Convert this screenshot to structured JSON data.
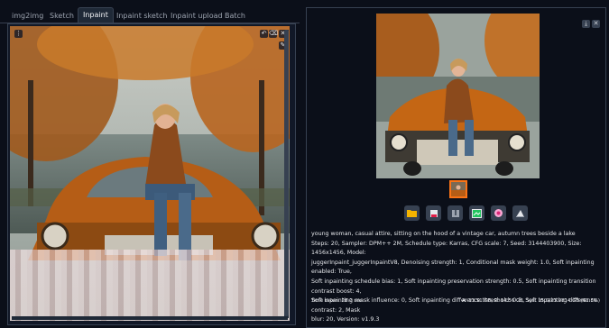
{
  "tabs": [
    "img2img",
    "Sketch",
    "Inpaint",
    "Inpaint sketch",
    "Inpaint upload",
    "Batch"
  ],
  "active_tab": "Inpaint",
  "output": {
    "prompt": "young woman, casual attire, sitting on the hood of a vintage car, autumn trees beside a lake",
    "params_1": "Steps: 20, Sampler: DPM++ 2M, Schedule type: Karras, CFG scale: 7, Seed: 3144403900, Size: 1456x1456, Model:",
    "params_2": "juggerInpaint_juggerInpaintV8, Denoising strength: 1, Conditional mask weight: 1.0, Soft inpainting enabled: True,",
    "params_3": "Soft inpainting schedule bias: 1, Soft inpainting preservation strength: 0.5, Soft inpainting transition contrast boost: 4,",
    "params_4": "Soft inpainting mask influence: 0, Soft inpainting difference threshold: 0.5, Soft inpainting difference contrast: 2, Mask",
    "params_5": "blur: 20, Version: v1.9.3",
    "time_taken": "Time taken: 28.2 sec.",
    "vram": "A: 13.51 GB, R: 14.56 GB, Sys: 15.0/23.9814 GB (61.3%)"
  },
  "toolbar_icons": [
    "folder-icon",
    "save-icon",
    "zip-icon",
    "send-to-img2img-icon",
    "send-to-inpaint-icon",
    "send-to-extras-icon"
  ],
  "accent_color": "#f97316"
}
